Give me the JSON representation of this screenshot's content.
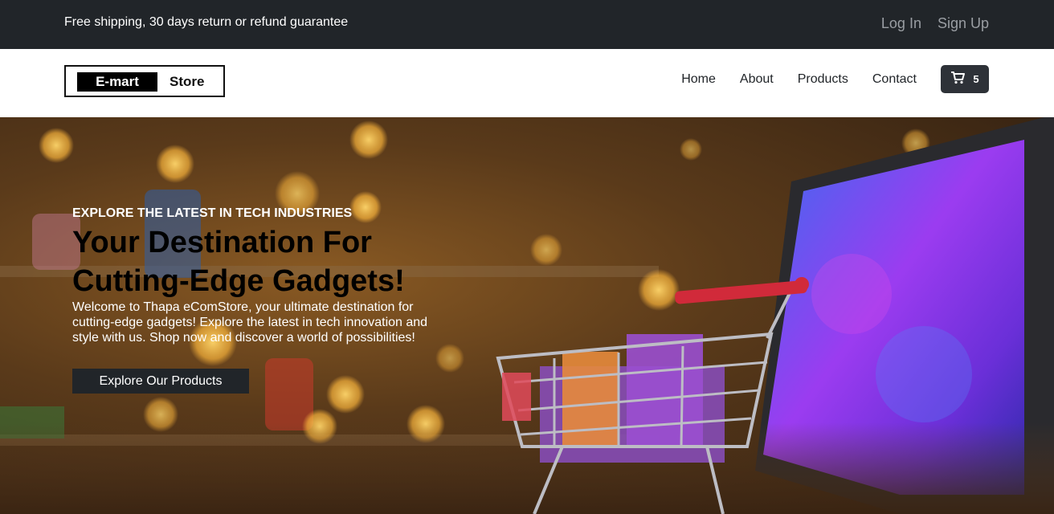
{
  "topbar": {
    "promo": "Free shipping, 30 days return or refund guarantee",
    "login": "Log In",
    "signup": "Sign Up"
  },
  "header": {
    "logo_left": "E-mart",
    "logo_right": "Store",
    "nav": [
      "Home",
      "About",
      "Products",
      "Contact"
    ],
    "cart_count": "5",
    "cart_icon": "shopping-cart-icon"
  },
  "hero": {
    "eyebrow": "EXPLORE THE LATEST IN TECH INDUSTRIES",
    "title": "Your Destination For Cutting-Edge Gadgets!",
    "description": "Welcome to Thapa eComStore, your ultimate destination for cutting-edge gadgets! Explore the latest in tech innovation and style with us. Shop now and discover a world of possibilities!",
    "cta": "Explore Our Products"
  },
  "colors": {
    "dark": "#212529",
    "muted": "#9a9ea3",
    "white": "#ffffff"
  }
}
